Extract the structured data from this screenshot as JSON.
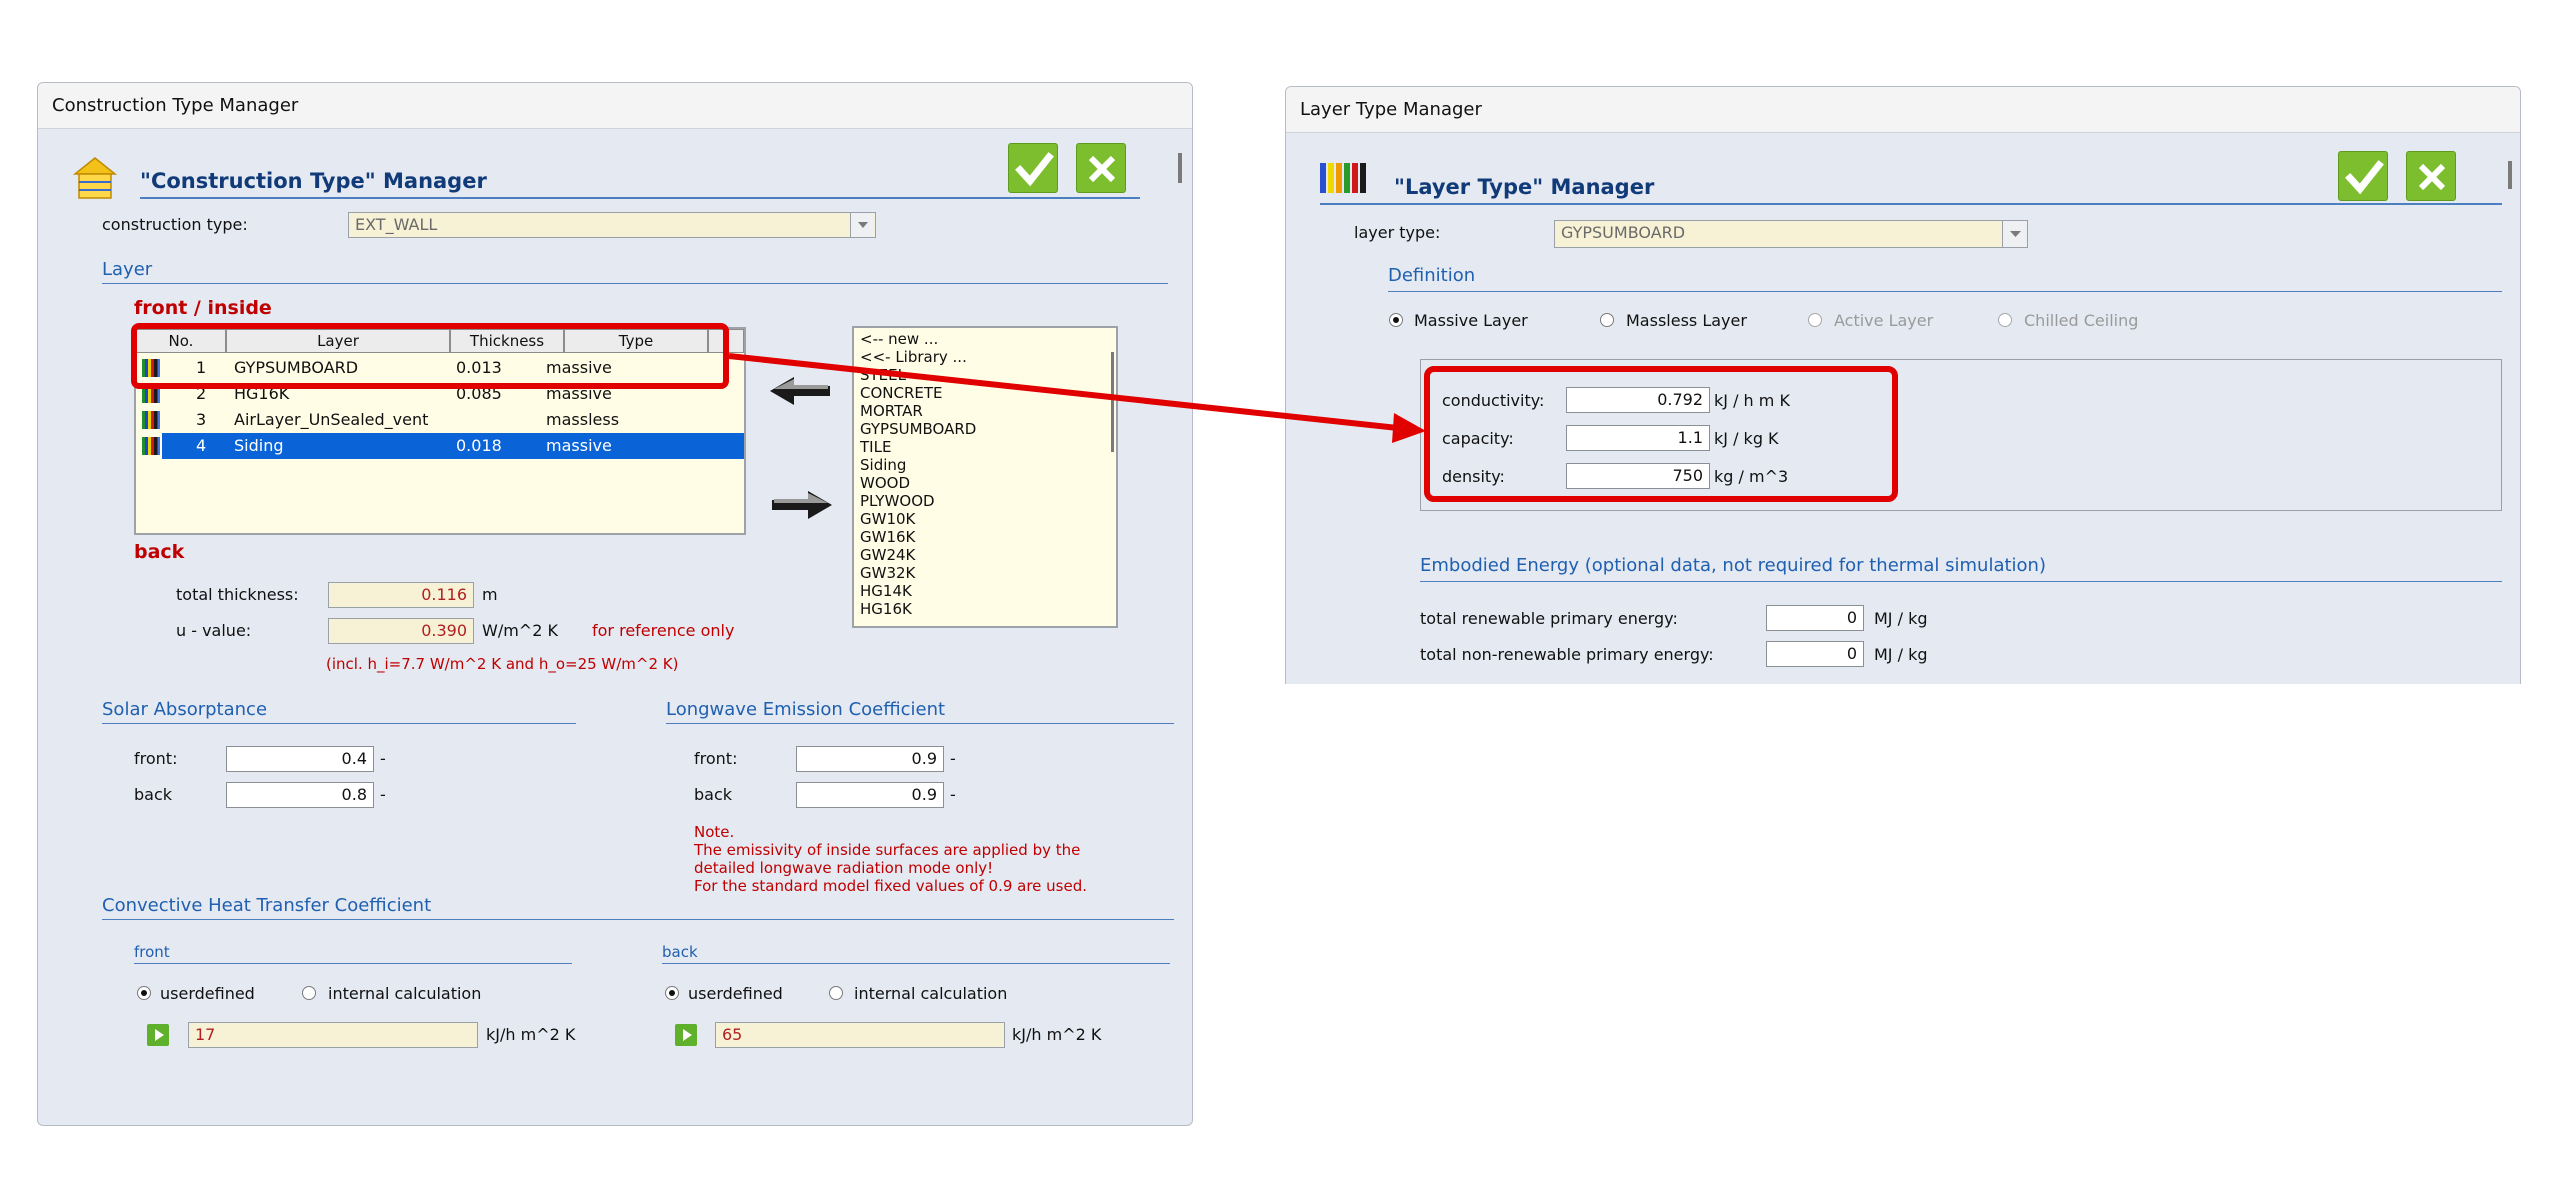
{
  "ctm": {
    "window_title": "Construction Type Manager",
    "heading": "\"Construction Type\" Manager",
    "construction_type_label": "construction type:",
    "construction_type_value": "EXT_WALL",
    "layer_section": "Layer",
    "front_inside": "front / inside",
    "back": "back",
    "columns": [
      "No.",
      "Layer",
      "Thickness",
      "Type"
    ],
    "rows": [
      {
        "no": "1",
        "layer": "GYPSUMBOARD",
        "thickness": "0.013",
        "type": "massive"
      },
      {
        "no": "2",
        "layer": "HG16K",
        "thickness": "0.085",
        "type": "massive"
      },
      {
        "no": "3",
        "layer": "AirLayer_UnSealed_vent",
        "thickness": "",
        "type": "massless"
      },
      {
        "no": "4",
        "layer": "Siding",
        "thickness": "0.018",
        "type": "massive"
      }
    ],
    "library_items": [
      "<-- new ...",
      "<<- Library ...",
      "STEEL",
      "CONCRETE",
      "MORTAR",
      "GYPSUMBOARD",
      "TILE",
      "Siding",
      "WOOD",
      "PLYWOOD",
      "GW10K",
      "GW16K",
      "GW24K",
      "GW32K",
      "HG14K",
      "HG16K"
    ],
    "total_thickness_label": "total thickness:",
    "total_thickness_value": "0.116",
    "total_thickness_unit": "m",
    "u_value_label": "u - value:",
    "u_value": "0.390",
    "u_value_unit": "W/m^2 K",
    "for_reference": "for reference only",
    "incl_note": "(incl. h_i=7.7 W/m^2 K and h_o=25 W/m^2 K)",
    "solar_section": "Solar Absorptance",
    "solar_front_label": "front:",
    "solar_front_value": "0.4",
    "solar_back_label": "back",
    "solar_back_value": "0.8",
    "dash": "-",
    "longwave_section": "Longwave Emission Coefficient",
    "lw_front_label": "front:",
    "lw_front_value": "0.9",
    "lw_back_label": "back",
    "lw_back_value": "0.9",
    "note_title": "Note.",
    "note_line1": "The emissivity of inside surfaces are applied by the",
    "note_line2": "detailed longwave radiation mode only!",
    "note_line3": "For the standard model fixed values of 0.9 are used.",
    "convective_section": "Convective Heat Transfer Coefficient",
    "conv_front_label": "front",
    "conv_back_label": "back",
    "userdefined": "userdefined",
    "internal_calculation": "internal calculation",
    "conv_front_value": "17",
    "conv_back_value": "65",
    "conv_unit": "kJ/h m^2 K"
  },
  "ltm": {
    "window_title": "Layer Type Manager",
    "heading": "\"Layer Type\" Manager",
    "layer_type_label": "layer type:",
    "layer_type_value": "GYPSUMBOARD",
    "definition_section": "Definition",
    "options": [
      "Massive Layer",
      "Massless Layer",
      "Active Layer",
      "Chilled Ceiling"
    ],
    "conductivity_label": "conductivity:",
    "conductivity_value": "0.792",
    "conductivity_unit": "kJ / h m K",
    "capacity_label": "capacity:",
    "capacity_value": "1.1",
    "capacity_unit": "kJ / kg K",
    "density_label": "density:",
    "density_value": "750",
    "density_unit": "kg / m^3",
    "embodied_section": "Embodied Energy (optional data, not required for thermal simulation)",
    "renewable_label": "total renewable primary energy:",
    "renewable_value": "0",
    "renewable_unit": "MJ / kg",
    "nonrenewable_label": "total non-renewable primary energy:",
    "nonrenewable_value": "0",
    "nonrenewable_unit": "MJ / kg"
  },
  "colors": {
    "window_bg": "#e4e9f2",
    "accent_blue": "#2060b0",
    "highlight_red": "#e00000",
    "selection_blue": "#0a64d8",
    "ok_green": "#7cbe2e"
  }
}
